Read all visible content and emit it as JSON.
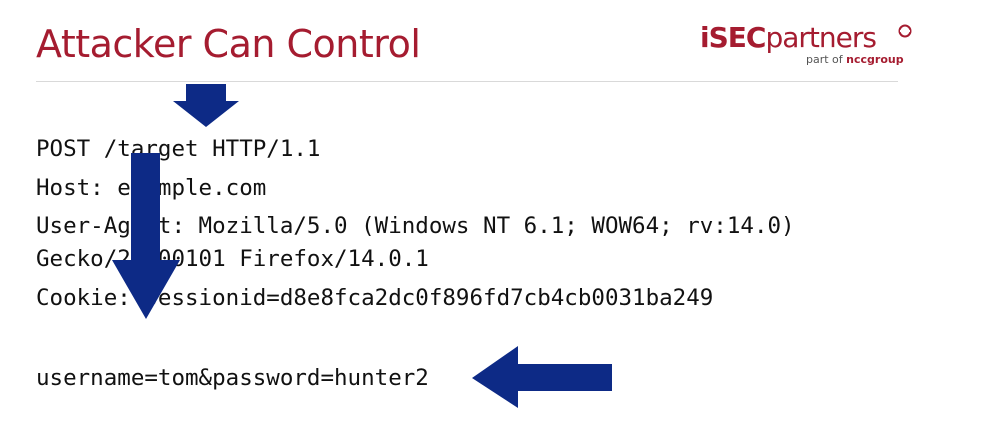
{
  "slide": {
    "title": "Attacker Can Control"
  },
  "logo": {
    "brand_bold": "iSEC",
    "brand_rest": "partners",
    "tagline_prefix": "part of ",
    "tagline_group": "nccgroup"
  },
  "request": {
    "request_line": "POST /target HTTP/1.1",
    "host": "Host: example.com",
    "user_agent_1": "User-Agent: Mozilla/5.0 (Windows NT 6.1; WOW64; rv:14.0)",
    "user_agent_2": "Gecko/20100101 Firefox/14.0.1",
    "cookie": "Cookie: sessionid=d8e8fca2dc0f896fd7cb4cb0031ba249",
    "body": "username=tom&password=hunter2"
  },
  "colors": {
    "title": "#a51c30",
    "arrow": "#0d2a86",
    "rule": "#d9d9d9"
  },
  "icons": {
    "arrow_url": "down-arrow-icon",
    "arrow_headers": "down-arrow-icon",
    "arrow_body": "left-arrow-icon"
  }
}
